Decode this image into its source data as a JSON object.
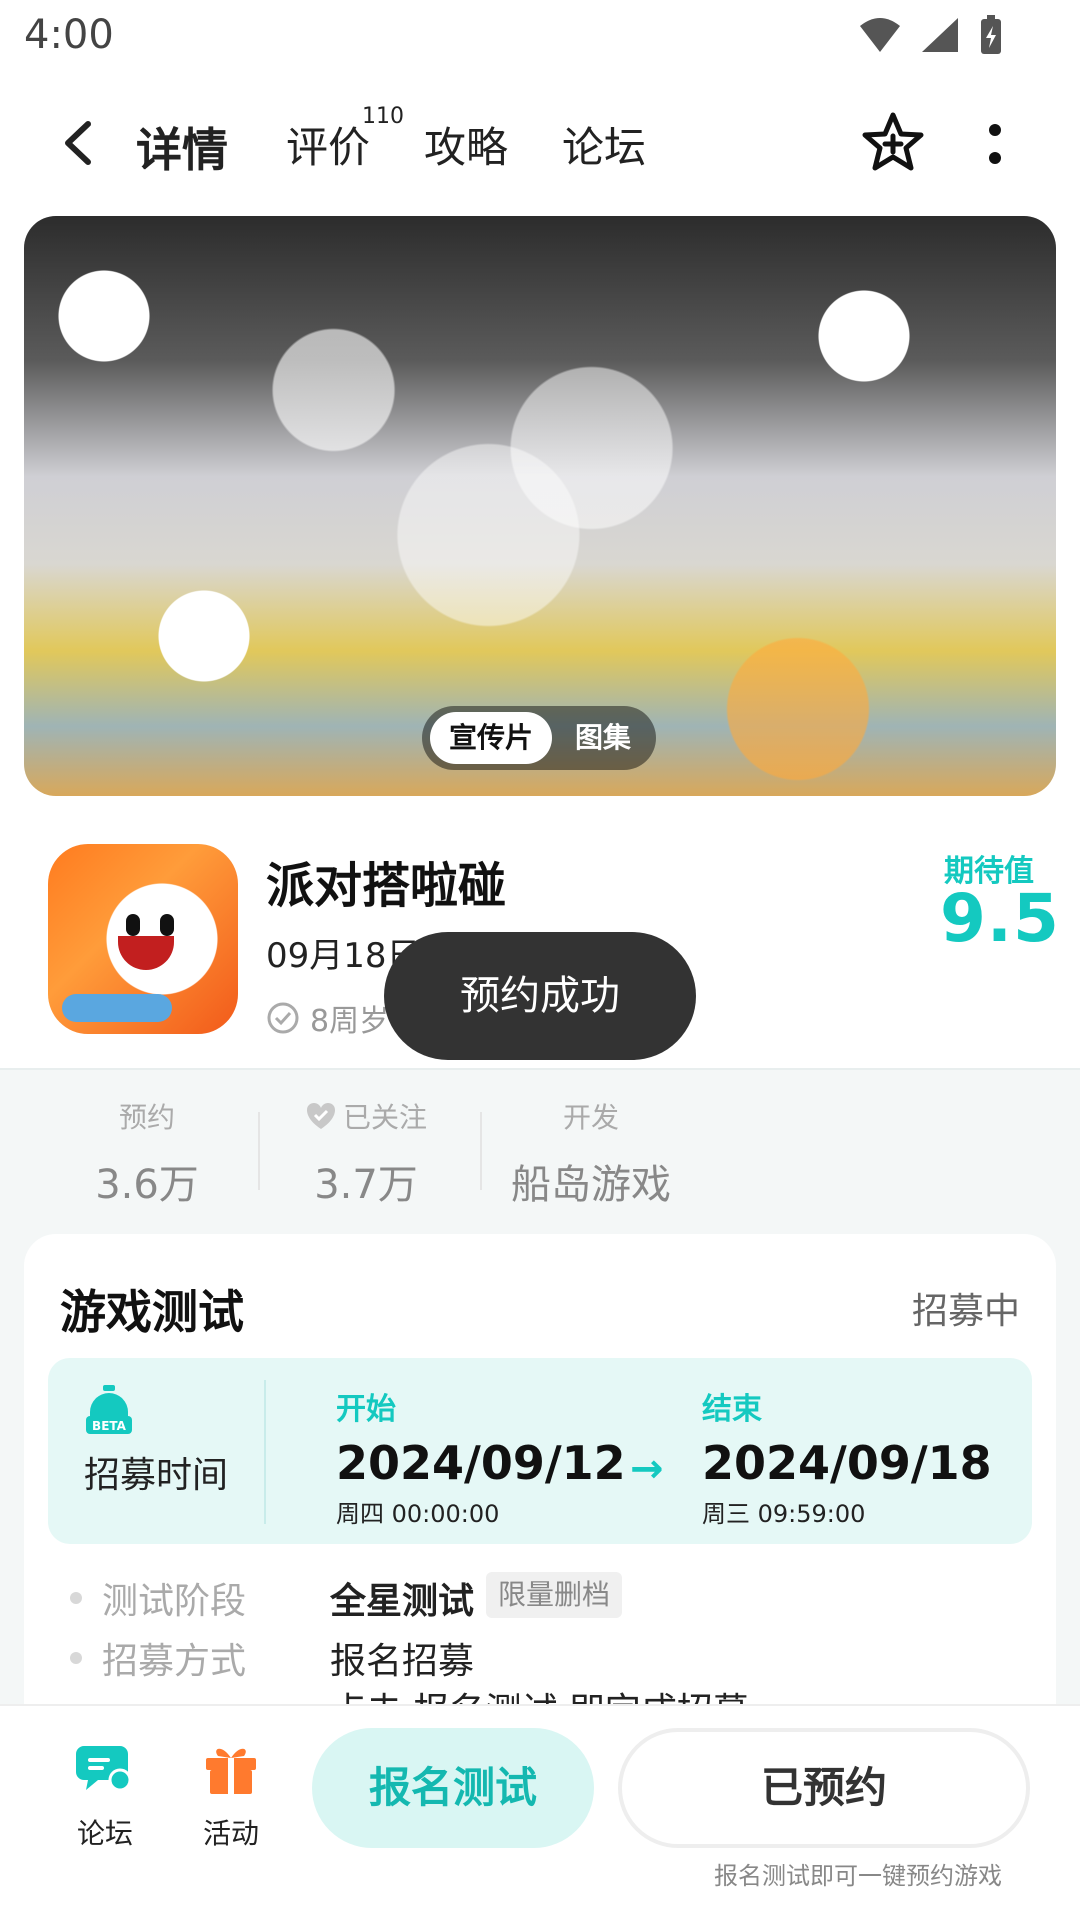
{
  "status_bar": {
    "time": "4:00"
  },
  "nav": {
    "tabs": [
      {
        "label": "详情"
      },
      {
        "label": "评价",
        "badge": "110"
      },
      {
        "label": "攻略"
      },
      {
        "label": "论坛"
      }
    ]
  },
  "media": {
    "switch": [
      "宣传片",
      "图集"
    ]
  },
  "game": {
    "title": "派对搭啦碰",
    "release": "09月18日",
    "age": "8周岁",
    "expect_label": "期待值",
    "expect_value": "9.5"
  },
  "toast": "预约成功",
  "stats": [
    {
      "label": "预约",
      "value": "3.6万"
    },
    {
      "label": "已关注",
      "value": "3.7万"
    },
    {
      "label": "开发",
      "value": "船岛游戏"
    }
  ],
  "test": {
    "title": "游戏测试",
    "status": "招募中",
    "recruit_label": "招募时间",
    "beta": "BETA",
    "start": {
      "label": "开始",
      "date": "2024/09/12",
      "week_time": "周四  00:00:00"
    },
    "end": {
      "label": "结束",
      "date": "2024/09/18",
      "week_time": "周三  09:59:00"
    },
    "arrow": "→",
    "rows": [
      {
        "label": "测试阶段",
        "value": "全星测试",
        "tag": "限量删档"
      },
      {
        "label": "招募方式",
        "value": "报名招募"
      }
    ],
    "partial": "点击 报名测试 即完成招募"
  },
  "bottom": {
    "forum": "论坛",
    "activity": "活动",
    "signup": "报名测试",
    "reserved": "已预约",
    "hint": "报名测试即可一键预约游戏"
  },
  "colors": {
    "accent": "#14c9c0",
    "toast_bg": "#333333"
  }
}
